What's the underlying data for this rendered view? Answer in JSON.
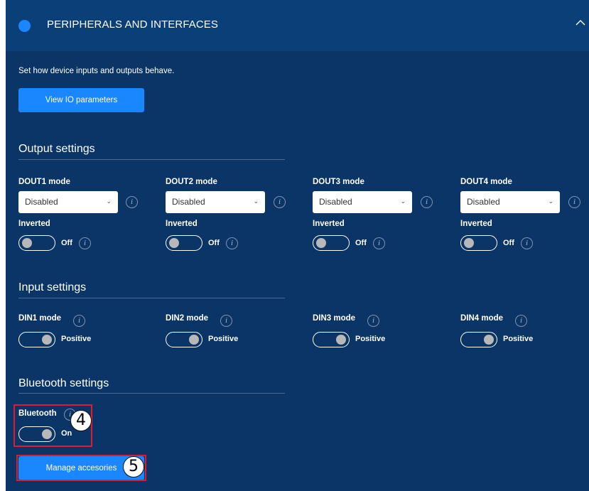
{
  "panel": {
    "title": "PERIPHERALS AND INTERFACES",
    "description": "Set how device inputs and outputs behave.",
    "view_button": "View IO parameters",
    "collapse_icon": "chevron-up-icon"
  },
  "output_settings": {
    "title": "Output settings",
    "outputs": [
      {
        "label": "DOUT1 mode",
        "value": "Disabled",
        "inverted_label": "Inverted",
        "inverted_state": "Off"
      },
      {
        "label": "DOUT2 mode",
        "value": "Disabled",
        "inverted_label": "Inverted",
        "inverted_state": "Off"
      },
      {
        "label": "DOUT3 mode",
        "value": "Disabled",
        "inverted_label": "Inverted",
        "inverted_state": "Off"
      },
      {
        "label": "DOUT4 mode",
        "value": "Disabled",
        "inverted_label": "Inverted",
        "inverted_state": "Off"
      }
    ]
  },
  "input_settings": {
    "title": "Input settings",
    "inputs": [
      {
        "label": "DIN1 mode",
        "state": "Positive"
      },
      {
        "label": "DIN2 mode",
        "state": "Positive"
      },
      {
        "label": "DIN3 mode",
        "state": "Positive"
      },
      {
        "label": "DIN4 mode",
        "state": "Positive"
      }
    ]
  },
  "bluetooth_settings": {
    "title": "Bluetooth settings",
    "bluetooth_label": "Bluetooth",
    "bluetooth_state": "On",
    "manage_button": "Manage accesories"
  },
  "callouts": {
    "bluetooth_marker": "4",
    "manage_marker": "5"
  },
  "icons": {
    "info": "i",
    "caret": "⌄"
  },
  "colors": {
    "background": "#0b3566",
    "header": "#0a3f78",
    "accent": "#1a86ff",
    "highlight": "#e01b2c"
  }
}
